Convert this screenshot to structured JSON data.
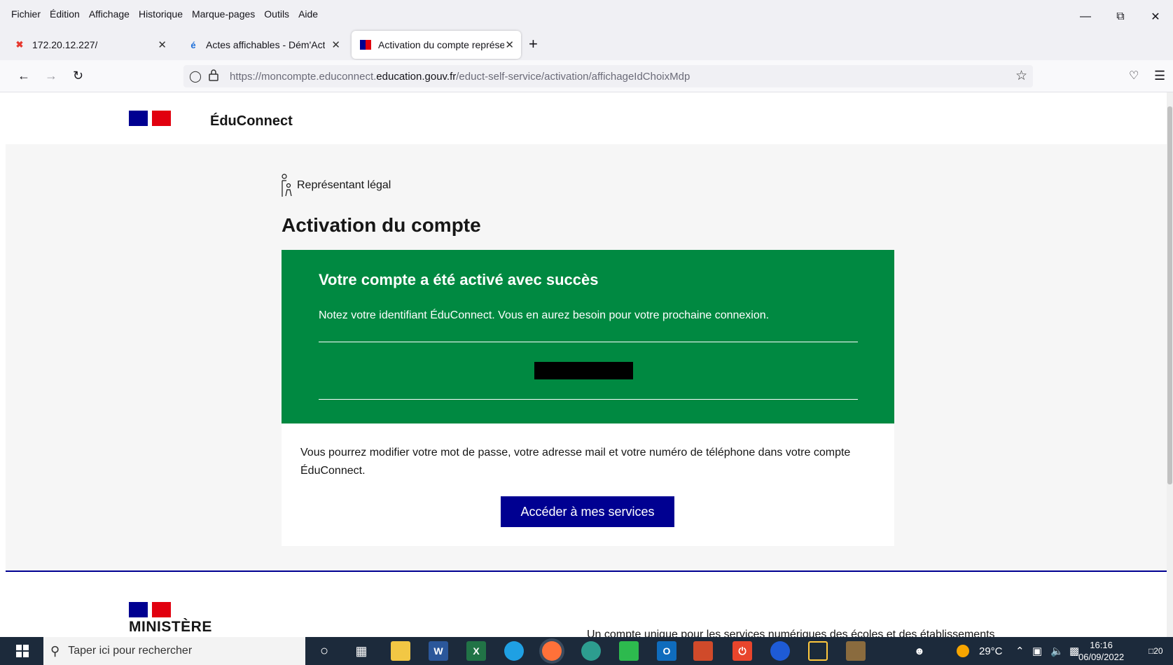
{
  "menu": [
    "Fichier",
    "Édition",
    "Affichage",
    "Historique",
    "Marque-pages",
    "Outils",
    "Aide"
  ],
  "tabs": [
    {
      "title": "172.20.12.227/"
    },
    {
      "title": "Actes affichables - Dém'Act"
    },
    {
      "title": "Activation du compte représent"
    }
  ],
  "nav": {
    "url_prefix": "https://moncompte.educonnect.",
    "url_domain": "education.gouv.fr",
    "url_path": "/educt-self-service/activation/affichageIdChoixMdp"
  },
  "header": {
    "brand": "ÉduConnect"
  },
  "main": {
    "role": "Représentant légal",
    "title": "Activation du compte",
    "success_title": "Votre compte a été activé avec succès",
    "success_text": "Notez votre identifiant ÉduConnect. Vous en aurez besoin pour votre prochaine connexion.",
    "info_text": "Vous pourrez modifier votre mot de passe, votre adresse mail et votre numéro de téléphone dans votre compte ÉduConnect.",
    "cta": "Accéder à mes services"
  },
  "footer": {
    "ministere": "MINISTÈRE",
    "tagline": "Un compte unique pour les services numériques des écoles et des établissements"
  },
  "taskbar": {
    "search_placeholder": "Taper ici pour rechercher",
    "weather": "29°C",
    "time": "16:16",
    "date": "06/09/2022",
    "notifications": "20"
  },
  "colors": {
    "success": "#008941",
    "primary": "#000091",
    "flag_red": "#e1000f"
  }
}
